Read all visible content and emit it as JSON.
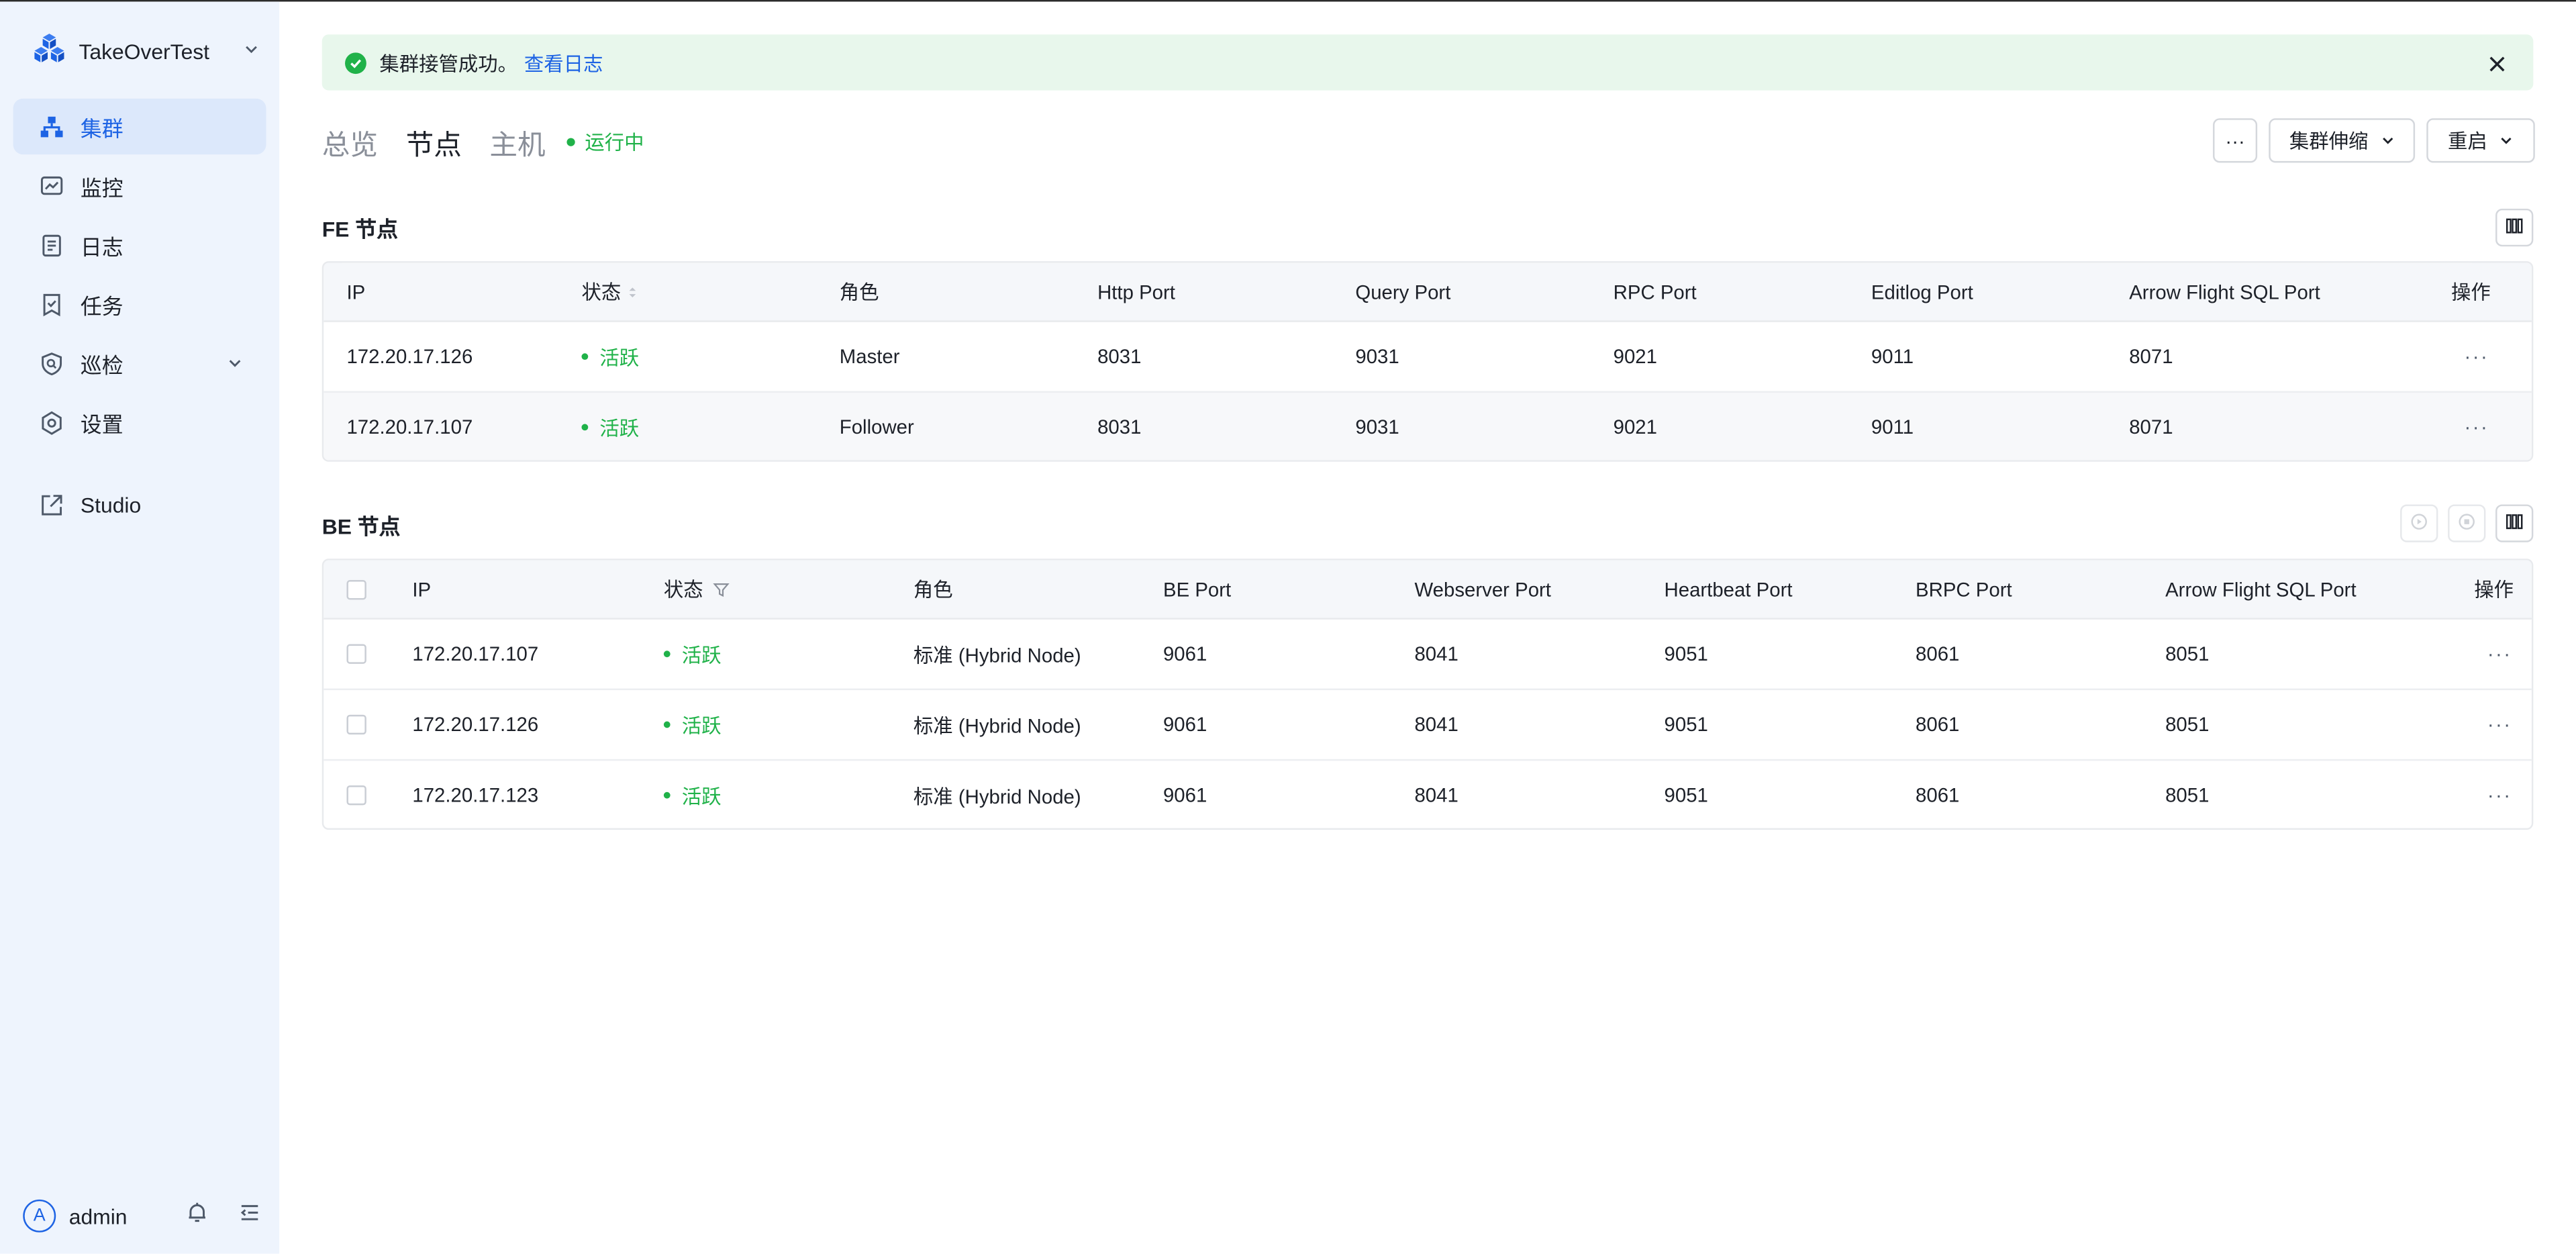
{
  "sidebar": {
    "cluster_name": "TakeOverTest",
    "items": [
      {
        "label": "集群",
        "icon": "cluster-icon",
        "active": true
      },
      {
        "label": "监控",
        "icon": "monitor-icon"
      },
      {
        "label": "日志",
        "icon": "log-icon"
      },
      {
        "label": "任务",
        "icon": "task-icon"
      },
      {
        "label": "巡检",
        "icon": "inspection-icon",
        "expandable": true
      },
      {
        "label": "设置",
        "icon": "settings-icon"
      }
    ],
    "studio_label": "Studio",
    "user": {
      "avatar_letter": "A",
      "name": "admin"
    }
  },
  "alert": {
    "message": "集群接管成功。",
    "link": "查看日志"
  },
  "tabs": [
    {
      "label": "总览",
      "active": false
    },
    {
      "label": "节点",
      "active": true
    },
    {
      "label": "主机",
      "active": false
    }
  ],
  "status": {
    "label": "运行中",
    "color": "#20b249"
  },
  "actions": {
    "more": "···",
    "scale": "集群伸缩",
    "restart": "重启"
  },
  "fe": {
    "title": "FE 节点",
    "columns": [
      "IP",
      "状态",
      "角色",
      "Http Port",
      "Query Port",
      "RPC Port",
      "Editlog Port",
      "Arrow Flight SQL Port",
      "操作"
    ],
    "rows": [
      {
        "ip": "172.20.17.126",
        "status": "活跃",
        "role": "Master",
        "http": "8031",
        "query": "9031",
        "rpc": "9021",
        "editlog": "9011",
        "arrow": "8071"
      },
      {
        "ip": "172.20.17.107",
        "status": "活跃",
        "role": "Follower",
        "http": "8031",
        "query": "9031",
        "rpc": "9021",
        "editlog": "9011",
        "arrow": "8071"
      }
    ]
  },
  "be": {
    "title": "BE 节点",
    "columns": [
      "IP",
      "状态",
      "角色",
      "BE Port",
      "Webserver Port",
      "Heartbeat Port",
      "BRPC Port",
      "Arrow Flight SQL Port",
      "操作"
    ],
    "rows": [
      {
        "ip": "172.20.17.107",
        "status": "活跃",
        "role": "标准 (Hybrid Node)",
        "be": "9061",
        "web": "8041",
        "hb": "9051",
        "brpc": "8061",
        "arrow": "8051"
      },
      {
        "ip": "172.20.17.126",
        "status": "活跃",
        "role": "标准 (Hybrid Node)",
        "be": "9061",
        "web": "8041",
        "hb": "9051",
        "brpc": "8061",
        "arrow": "8051"
      },
      {
        "ip": "172.20.17.123",
        "status": "活跃",
        "role": "标准 (Hybrid Node)",
        "be": "9061",
        "web": "8041",
        "hb": "9051",
        "brpc": "8061",
        "arrow": "8051"
      }
    ]
  },
  "colors": {
    "accent": "#1d63e4",
    "success": "#20b249"
  }
}
